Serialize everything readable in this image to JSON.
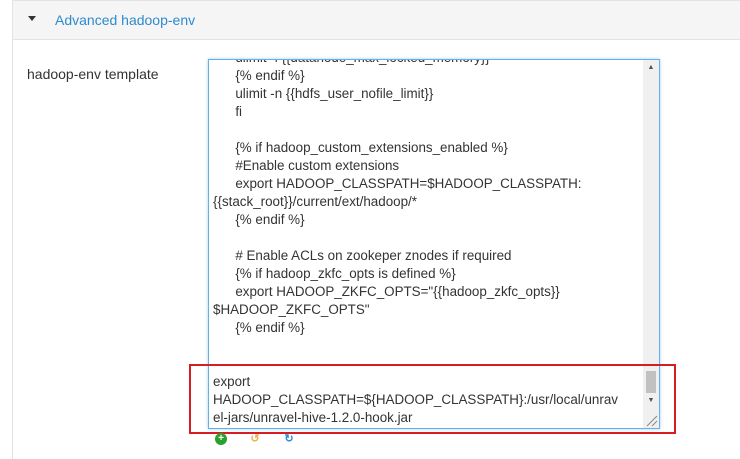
{
  "section": {
    "title": "Advanced hadoop-env",
    "expanded_icon": "caret-down-icon"
  },
  "field": {
    "label": "hadoop-env template",
    "value_lines": [
      "      ulimit -l {{datanode_max_locked_memory}}",
      "      {% endif %}",
      "      ulimit -n {{hdfs_user_nofile_limit}}",
      "      fi",
      "",
      "      {% if hadoop_custom_extensions_enabled %}",
      "      #Enable custom extensions",
      "      export HADOOP_CLASSPATH=$HADOOP_CLASSPATH:",
      "{{stack_root}}/current/ext/hadoop/*",
      "      {% endif %}",
      "",
      "      # Enable ACLs on zookeper znodes if required",
      "      {% if hadoop_zkfc_opts is defined %}",
      "      export HADOOP_ZKFC_OPTS=\"{{hadoop_zkfc_opts}}",
      "$HADOOP_ZKFC_OPTS\"",
      "      {% endif %}",
      "",
      "",
      "export",
      "HADOOP_CLASSPATH=${HADOOP_CLASSPATH}:/usr/local/unrav",
      "el-jars/unravel-hive-1.2.0-hook.jar"
    ]
  },
  "actions": {
    "add_icon": "plus-circle-icon",
    "undo_icon": "undo-icon",
    "refresh_icon": "refresh-icon"
  },
  "colors": {
    "link": "#2c8bcf",
    "highlight_border": "#d91c24",
    "focus_border": "#66afe9"
  }
}
